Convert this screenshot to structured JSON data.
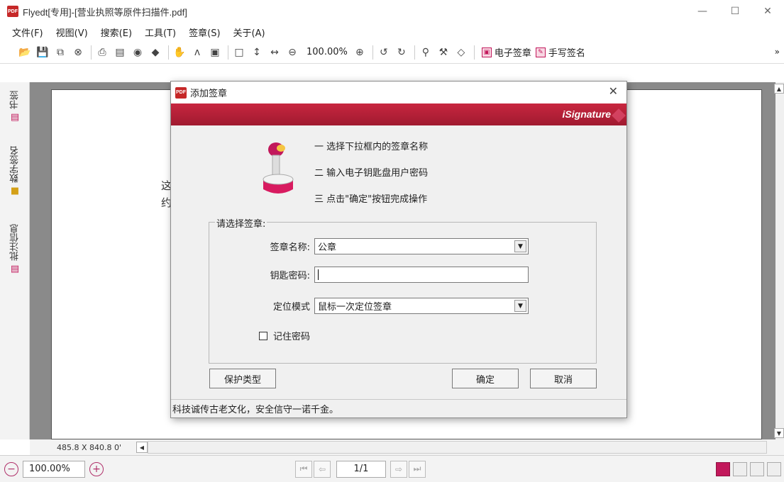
{
  "window": {
    "app_icon": "PDF",
    "title": "Flyedt[专用]-[营业执照等原件扫描件.pdf]",
    "controls": [
      "—",
      "☐",
      "✕"
    ]
  },
  "menubar": {
    "items": [
      "文件(F)",
      "视图(V)",
      "搜索(E)",
      "工具(T)",
      "签章(S)",
      "关于(A)"
    ]
  },
  "toolbar": {
    "zoom": "100.00%",
    "esign_label": "电子签章",
    "handwrite_label": "手写签名",
    "overflow": "»"
  },
  "sidepanel": {
    "tabs": [
      "书签",
      "数字签名",
      "批注信息"
    ]
  },
  "document": {
    "fragments": [
      "这",
      "约"
    ]
  },
  "pagesize": "485.8 X 840.8 0'",
  "statusbar": {
    "zoom": "100.00%",
    "page": "1/1"
  },
  "dialog": {
    "title": "添加签章",
    "close": "✕",
    "brand": "iSignature",
    "steps": [
      "一 选择下拉框内的签章名称",
      "二 输入电子钥匙盘用户密码",
      "三 点击\"确定\"按钮完成操作"
    ],
    "group_title": "请选择签章:",
    "fields": {
      "seal_name_label": "签章名称:",
      "seal_name_value": "公章",
      "password_label": "钥匙密码:",
      "password_value": "",
      "position_label": "定位模式",
      "position_value": "鼠标一次定位签章"
    },
    "remember_label": "记住密码",
    "protect_button": "保护类型",
    "ok_button": "确定",
    "cancel_button": "取消",
    "status": "科技诚传古老文化，安全信守一诺千金。"
  },
  "colors": {
    "banner": "#b52035",
    "accent": "#c2185b"
  }
}
